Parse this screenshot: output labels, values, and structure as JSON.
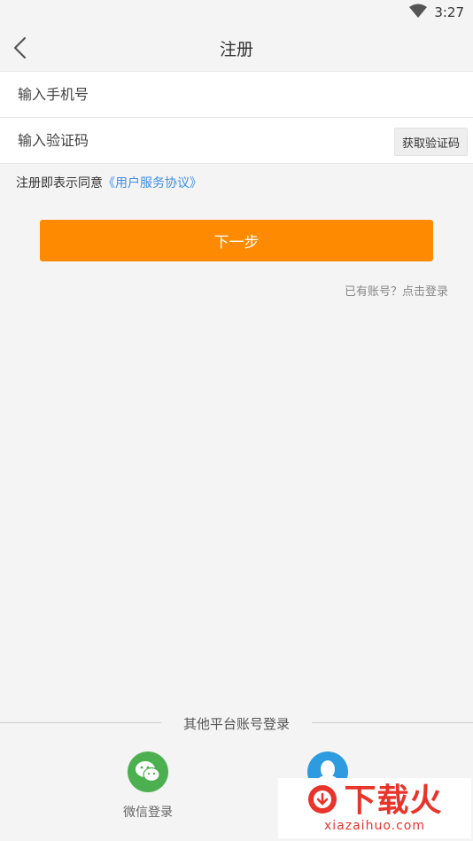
{
  "status_bar": {
    "time": "3:27",
    "wifi_icon": "wifi-icon"
  },
  "header": {
    "title": "注册",
    "back_icon": "back-arrow-icon"
  },
  "form": {
    "phone_placeholder": "输入手机号",
    "code_placeholder": "输入验证码",
    "get_code_label": "获取验证码"
  },
  "agreement": {
    "prefix": "注册即表示同意",
    "link": "《用户服务协议》"
  },
  "next_button": {
    "label": "下一步"
  },
  "login_link": {
    "label": "已有账号？点击登录"
  },
  "other_login": {
    "divider_text": "其他平台账号登录",
    "wechat_label": "微信登录",
    "qq_icon": "qq-icon"
  },
  "watermark": {
    "name": "下载火",
    "url": "xiazaihuo.com"
  },
  "colors": {
    "accent": "#fd8a00",
    "link": "#3d8ee8",
    "wechat": "#4caf50",
    "qq": "#2e9be0",
    "watermark": "#e8342a"
  }
}
